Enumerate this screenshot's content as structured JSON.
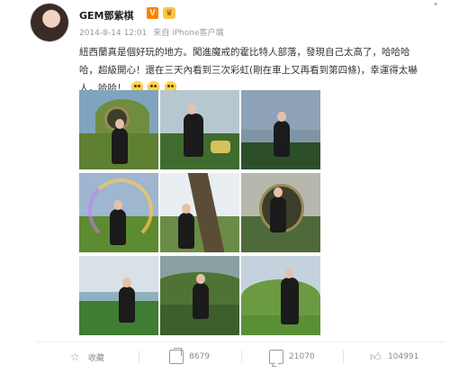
{
  "header": {
    "username": "GEM鄧紫棋",
    "vip_badge": "V",
    "crown_badge": "♛",
    "timestamp": "2014-8-14 12:01",
    "source": "来自 iPhone客户端",
    "menu_arrow": "˅"
  },
  "post": {
    "text": "紐西蘭真是個好玩的地方。闖進魔戒的霍比特人部落，發現自己太高了，哈哈哈哈，超級開心！還在三天內看到三次彩虹(剛在車上又再看到第四條)，幸運得太嚇人，哈哈！"
  },
  "photos": [
    {
      "label": "hobbit-door-photo"
    },
    {
      "label": "smiling-selfie-photo"
    },
    {
      "label": "lake-photo"
    },
    {
      "label": "rainbow-photo"
    },
    {
      "label": "tree-photo"
    },
    {
      "label": "round-door-photo"
    },
    {
      "label": "field-photo"
    },
    {
      "label": "garden-photo"
    },
    {
      "label": "hill-path-photo"
    }
  ],
  "toolbar": {
    "favorite_label": "收藏",
    "repost_count": "8679",
    "comment_count": "21070",
    "like_count": "104991"
  },
  "colors": {
    "text": "#333333",
    "muted": "#9b9b9b",
    "accent": "#ff8200"
  }
}
